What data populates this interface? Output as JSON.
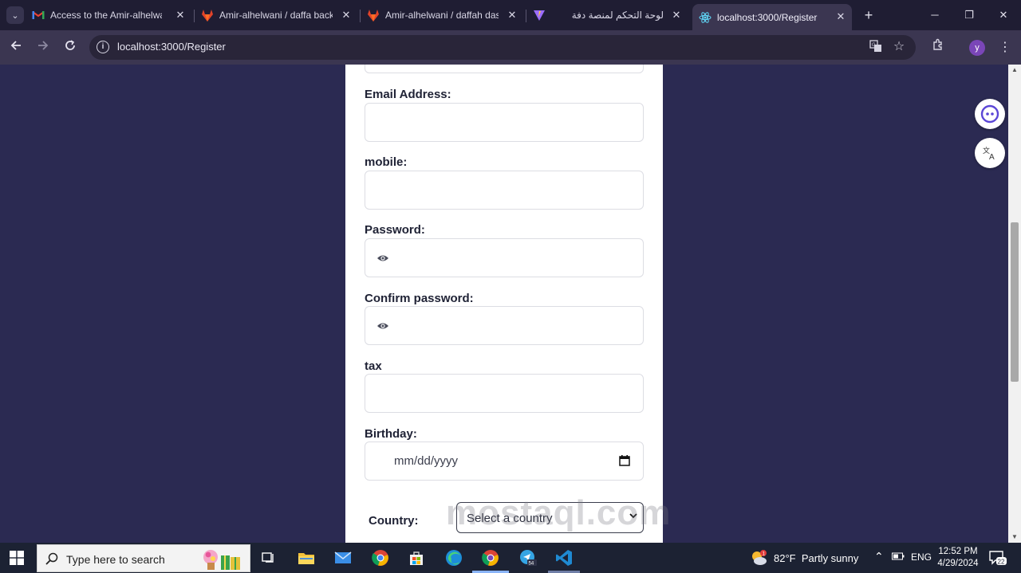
{
  "tabs": [
    {
      "title": "Access to the Amir-alhelwani",
      "favicon": "gmail-icon"
    },
    {
      "title": "Amir-alhelwani / daffa backend",
      "favicon": "gitlab-icon"
    },
    {
      "title": "Amir-alhelwani / daffah dashboard",
      "favicon": "gitlab-icon"
    },
    {
      "title": "",
      "favicon": "vite-icon"
    },
    {
      "title": "لوحة التحكم لمنصة دفة",
      "favicon": ""
    },
    {
      "title": "localhost:3000/Register",
      "favicon": "react-icon",
      "active": true
    }
  ],
  "address_bar": {
    "url": "localhost:3000/Register"
  },
  "profile": {
    "initial": "y"
  },
  "form": {
    "email_label": "Email Address:",
    "mobile_label": "mobile:",
    "password_label": "Password:",
    "confirm_password_label": "Confirm password:",
    "tax_label": "tax",
    "birthday_label": "Birthday:",
    "birthday_placeholder": "mm/dd/yyyy",
    "country_label": "Country:",
    "country_placeholder": "Select a country"
  },
  "watermark": "mostaql.com",
  "taskbar": {
    "search_placeholder": "Type here to search",
    "terminal_badge": "54",
    "weather_temp": "82°F",
    "weather_desc": "Partly sunny",
    "weather_badge": "1",
    "language": "ENG",
    "time": "12:52 PM",
    "date": "4/29/2024",
    "notification_count": "22"
  },
  "colors": {
    "page_background": "#2b2a52",
    "card": "#ffffff",
    "tab_bar": "#1f1d33",
    "toolbar": "#3b3651",
    "taskbar": "#1c2233"
  }
}
